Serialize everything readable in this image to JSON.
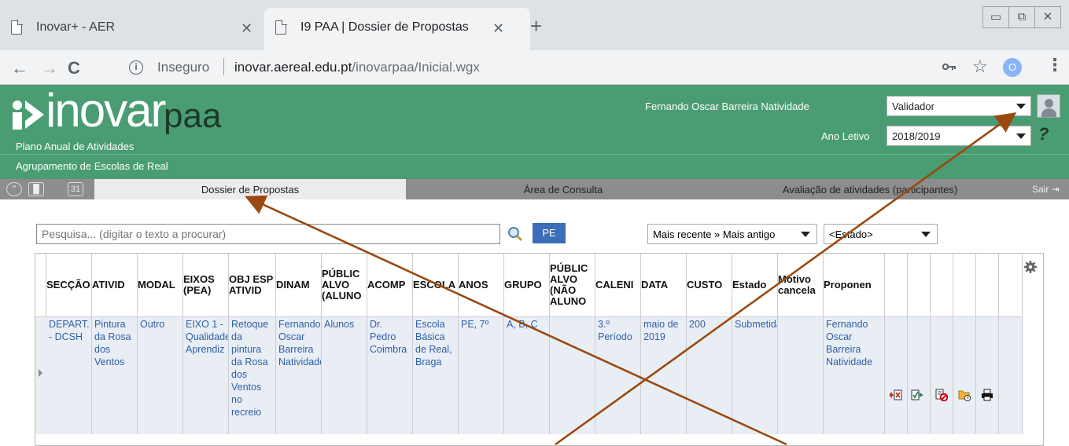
{
  "browser": {
    "tabs": [
      {
        "title": "Inovar+ - AER",
        "close": "✕"
      },
      {
        "title": "I9 PAA | Dossier de Propostas",
        "close": "✕"
      }
    ],
    "new_tab": "+",
    "window_buttons": {
      "minimize": "▭",
      "restore": "⧉",
      "close": "✕"
    },
    "nav": {
      "back": "←",
      "forward": "→",
      "reload": "C"
    },
    "address": {
      "security_label": "Inseguro",
      "host": "inovar.aereal.edu.pt",
      "path": "/inovarpaa/Inicial.wgx"
    },
    "profile_initial": "O",
    "menu": "⋮",
    "star": "☆"
  },
  "app": {
    "logo": {
      "word": "inovar",
      "suffix": "paa"
    },
    "plan_title": "Plano Anual de Atividades",
    "school_group": "Agrupamento de Escolas de Real",
    "user_name": "Fernando Oscar Barreira Natividade",
    "role": "Validador",
    "year_label": "Ano Letivo",
    "year": "2018/2019",
    "help": "?"
  },
  "navbar": {
    "tabs": [
      "Dossier de Propostas",
      "Área de Consulta",
      "Avaliação de atividades (participantes)"
    ],
    "calendar_day": "31",
    "exit_label": "Sair"
  },
  "filters": {
    "search_placeholder": "Pesquisa... (digitar o texto a procurar)",
    "pe_button": "PE",
    "order": "Mais recente » Mais antigo",
    "status": "<Estado>"
  },
  "grid": {
    "headers": [
      "SECÇÃO",
      "ATIVID",
      "MODAL",
      "EIXOS (PEA)",
      "OBJ ESP ATIVID",
      "DINAM",
      "PÚBLIC ALVO (ALUNO",
      "ACOMP",
      "ESCOLA",
      "ANOS",
      "GRUPO",
      "PÚBLIC ALVO (NÃO ALUNO",
      "CALENI",
      "DATA",
      "CUSTO",
      "Estado",
      "Motivo cancela",
      "Proponen"
    ],
    "rows": [
      {
        "cells": [
          "DEPART. - DCSH",
          "Pintura da Rosa dos Ventos",
          "Outro",
          "EIXO 1 - Qualidade Aprendiz",
          "Retoque da pintura da Rosa dos Ventos no recreio",
          "Fernando Oscar Barreira Natividade",
          "Alunos",
          "Dr. Pedro Coimbra",
          "Escola Básica de Real, Braga",
          "PE, 7º",
          "A, B, C",
          "",
          "3.º Período",
          "maio de 2019",
          "200",
          "Submetida",
          "",
          "Fernando Oscar Barreira Natividade"
        ]
      }
    ]
  },
  "colors": {
    "header_green": "#4a9d72",
    "nav_gray": "#8d8d8d",
    "link_blue": "#2e5fa6",
    "arrow_brown": "#9a4a10"
  }
}
